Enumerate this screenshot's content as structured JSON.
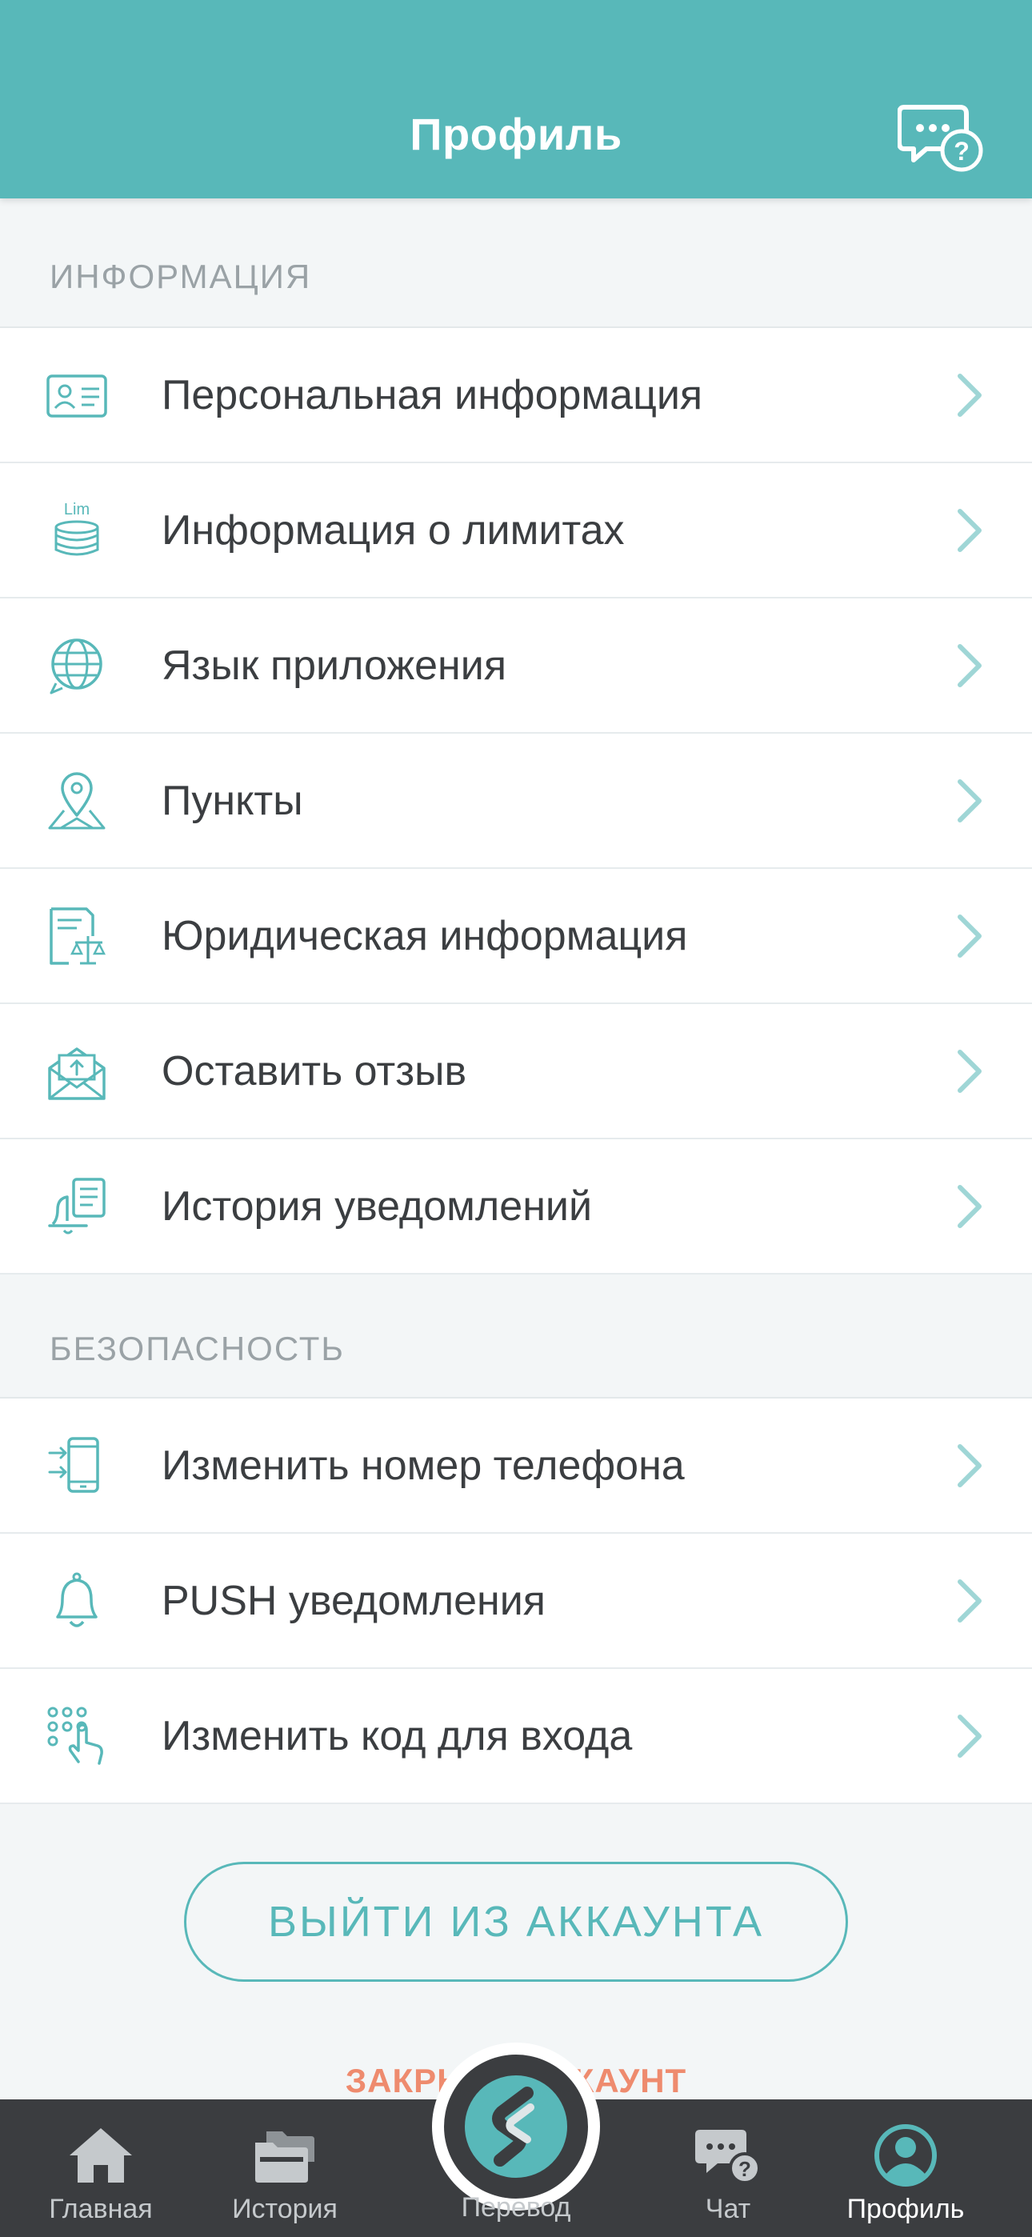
{
  "header": {
    "title": "Профиль",
    "support_icon": "chat-question-icon"
  },
  "sections": {
    "info": {
      "label": "ИНФОРМАЦИЯ",
      "items": [
        {
          "label": "Персональная информация",
          "icon": "id-card-icon"
        },
        {
          "label": "Информация о лимитах",
          "icon": "limits-coins-icon",
          "icon_text": "Lim"
        },
        {
          "label": "Язык приложения",
          "icon": "globe-icon"
        },
        {
          "label": "Пункты",
          "icon": "map-pin-icon"
        },
        {
          "label": "Юридическая информация",
          "icon": "legal-scales-icon"
        },
        {
          "label": "Оставить отзыв",
          "icon": "envelope-upload-icon"
        },
        {
          "label": "История уведомлений",
          "icon": "notification-history-icon"
        }
      ]
    },
    "security": {
      "label": "БЕЗОПАСНОСТЬ",
      "items": [
        {
          "label": "Изменить номер телефона",
          "icon": "phone-change-icon"
        },
        {
          "label": "PUSH уведомления",
          "icon": "bell-icon"
        },
        {
          "label": "Изменить код для входа",
          "icon": "keypad-touch-icon"
        }
      ]
    }
  },
  "actions": {
    "logout_label": "ВЫЙТИ ИЗ АККАУНТА",
    "close_account_label": "ЗАКРЫТЬ АККАУНТ"
  },
  "tabbar": {
    "home": "Главная",
    "history": "История",
    "transfer": "Перевод",
    "chat": "Чат",
    "profile": "Профиль",
    "active": "profile"
  },
  "colors": {
    "accent": "#58b8b9",
    "tabbar": "#3b3d40",
    "danger": "#ee8b6e"
  }
}
